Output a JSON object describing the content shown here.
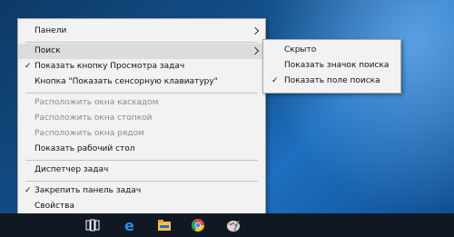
{
  "context_menu": {
    "items": [
      {
        "label": "Панели",
        "submenu": true
      },
      {
        "label": "Поиск",
        "submenu": true,
        "highlighted": true
      },
      {
        "label": "Показать кнопку Просмотра задач",
        "checked": true
      },
      {
        "label": "Кнопка \"Показать сенсорную клавиатуру\""
      },
      {
        "label": "Расположить окна каскадом",
        "disabled": true
      },
      {
        "label": "Расположить окна стопкой",
        "disabled": true
      },
      {
        "label": "Расположить окна рядом",
        "disabled": true
      },
      {
        "label": "Показать рабочий стол"
      },
      {
        "label": "Диспетчер задач"
      },
      {
        "label": "Закрепить панель задач",
        "checked": true
      },
      {
        "label": "Свойства"
      }
    ]
  },
  "search_submenu": {
    "items": [
      {
        "label": "Скрыто"
      },
      {
        "label": "Показать значок поиска"
      },
      {
        "label": "Показать поле поиска",
        "checked": true
      }
    ]
  },
  "symbols": {
    "check": "✓"
  },
  "taskbar": {
    "icons": [
      "task-view-icon",
      "edge-icon",
      "file-explorer-icon",
      "chrome-icon",
      "paint-icon"
    ]
  }
}
